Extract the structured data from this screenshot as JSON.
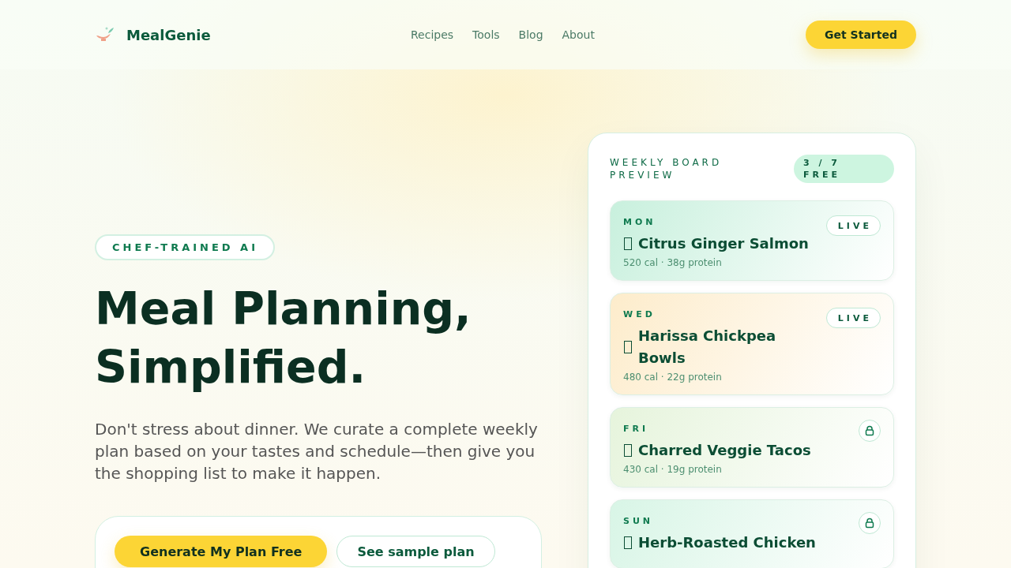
{
  "header": {
    "brand": "MealGenie",
    "nav": [
      {
        "label": "Recipes"
      },
      {
        "label": "Tools"
      },
      {
        "label": "Blog"
      },
      {
        "label": "About"
      }
    ],
    "cta": "Get Started"
  },
  "hero": {
    "badge": "CHEF-TRAINED AI",
    "title_lines": [
      "Meal Planning,",
      "Simplified."
    ],
    "description": "Don't stress about dinner. We curate a complete weekly plan based on your tastes and schedule—then give you the shopping list to make it happen.",
    "buttons": [
      {
        "label": "Generate My Plan Free",
        "kind": "primary"
      },
      {
        "label": "See sample plan",
        "kind": "secondary"
      }
    ]
  },
  "board": {
    "title": "WEEKLY BOARD PREVIEW",
    "count": "3 / 7 FREE",
    "meals": [
      {
        "day": "MON",
        "name": "Citrus Ginger Salmon",
        "meta": "520 cal · 38g protein",
        "locked": false,
        "badge": "LIVE",
        "color": "#c8f0dd"
      },
      {
        "day": "WED",
        "name": "Harissa Chickpea Bowls",
        "meta": "480 cal · 22g protein",
        "locked": false,
        "badge": "LIVE",
        "color": "#fdeccb"
      },
      {
        "day": "FRI",
        "name": "Charred Veggie Tacos",
        "meta": "430 cal · 19g protein",
        "locked": true,
        "color": "#e6f4dc"
      },
      {
        "day": "SUN",
        "name": "Herb-Roasted Chicken",
        "locked": true,
        "color": "#d8f5e6"
      }
    ]
  }
}
